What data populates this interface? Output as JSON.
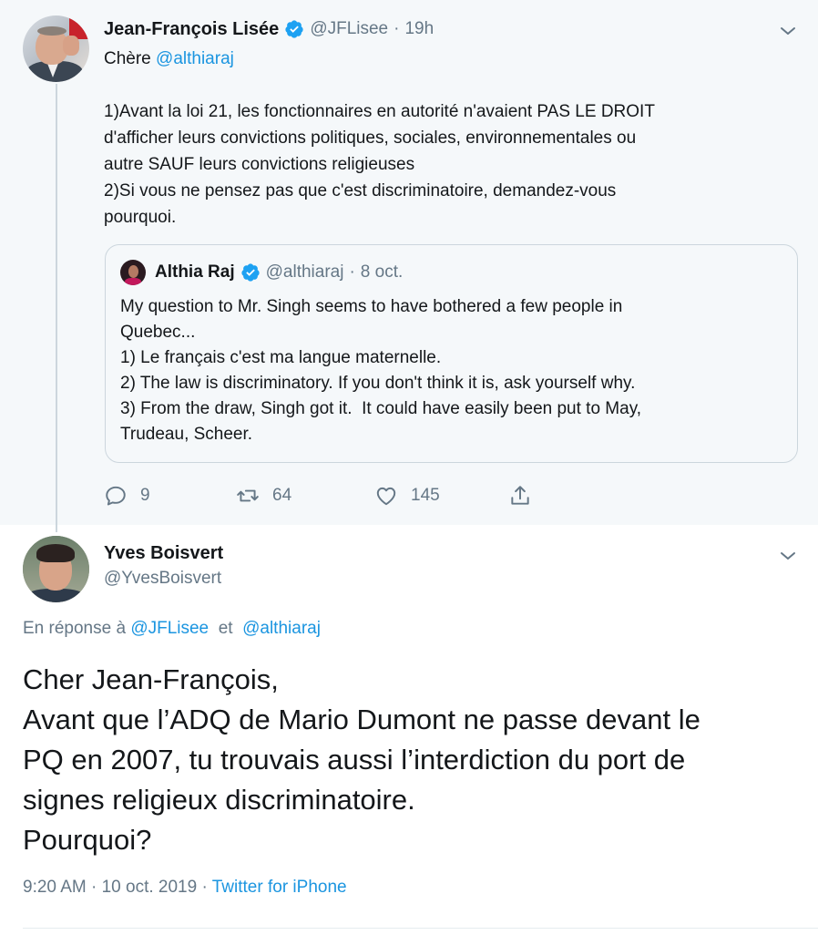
{
  "parent_tweet": {
    "author_name": "Jean-François Lisée",
    "author_handle": "@JFLisee",
    "time_separator": "·",
    "time": "19h",
    "greeting_prefix": "Chère ",
    "greeting_mention": "@althiaraj",
    "text": "1)Avant la loi 21, les fonctionnaires en autorité n'avaient PAS LE DROIT\nd'afficher leurs convictions politiques, sociales, environnementales ou\nautre SAUF leurs convictions religieuses\n2)Si vous ne pensez pas que c'est discriminatoire, demandez-vous\npourquoi.",
    "quoted": {
      "author_name": "Althia Raj",
      "author_handle": "@althiaraj",
      "time_separator": "·",
      "date": "8 oct.",
      "text": "My question to Mr. Singh seems to have bothered a few people in\nQuebec...\n1) Le français c'est ma langue maternelle.\n2) The law is discriminatory. If you don't think it is, ask yourself why.\n3) From the draw, Singh got it.  It could have easily been put to May,\nTrudeau, Scheer."
    },
    "actions": {
      "replies": "9",
      "retweets": "64",
      "likes": "145"
    }
  },
  "reply_tweet": {
    "author_name": "Yves Boisvert",
    "author_handle": "@YvesBoisvert",
    "in_reply_prefix": "En réponse à ",
    "in_reply_mention_1": "@JFLisee",
    "in_reply_joiner": "  et  ",
    "in_reply_mention_2": "@althiaraj",
    "text": "Cher Jean-François,\nAvant que l’ADQ de Mario Dumont ne passe devant le\nPQ en 2007, tu trouvais aussi l’interdiction du port de\nsignes religieux discriminatoire.\nPourquoi?",
    "time": "9:20 AM",
    "meta_separator": " · ",
    "date": "10 oct. 2019",
    "source": "Twitter for iPhone"
  },
  "colors": {
    "accent": "#1b95e0",
    "secondary_text": "#657786",
    "verified": "#1da1f2",
    "thread_bg": "#f5f8fa"
  },
  "icons": [
    "verified-badge-icon",
    "chevron-down-icon",
    "reply-icon",
    "retweet-icon",
    "like-icon",
    "share-icon"
  ]
}
